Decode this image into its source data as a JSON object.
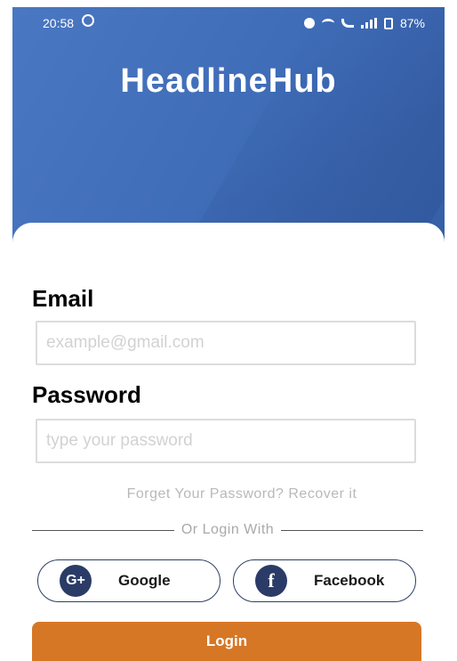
{
  "status_bar": {
    "time": "20:58",
    "battery": "87%"
  },
  "app": {
    "title": "HeadlineHub"
  },
  "form": {
    "email_label": "Email",
    "email_placeholder": "example@gmail.com",
    "password_label": "Password",
    "password_placeholder": "type your password",
    "recover_text": "Forget Your Password? Recover it",
    "or_login_with": "Or Login With",
    "google_label": "Google",
    "facebook_label": "Facebook",
    "login_label": "Login"
  },
  "colors": {
    "header": "#4470bd",
    "login_button": "#d67725",
    "social_icon": "#2b3b67"
  }
}
